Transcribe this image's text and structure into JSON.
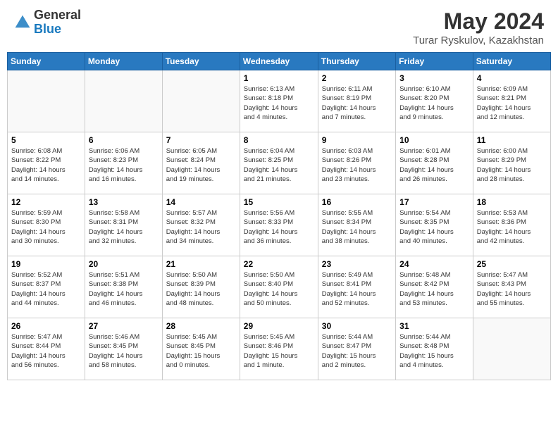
{
  "header": {
    "logo_general": "General",
    "logo_blue": "Blue",
    "title": "May 2024",
    "subtitle": "Turar Ryskulov, Kazakhstan"
  },
  "days_of_week": [
    "Sunday",
    "Monday",
    "Tuesday",
    "Wednesday",
    "Thursday",
    "Friday",
    "Saturday"
  ],
  "weeks": [
    [
      {
        "day": "",
        "info": ""
      },
      {
        "day": "",
        "info": ""
      },
      {
        "day": "",
        "info": ""
      },
      {
        "day": "1",
        "info": "Sunrise: 6:13 AM\nSunset: 8:18 PM\nDaylight: 14 hours\nand 4 minutes."
      },
      {
        "day": "2",
        "info": "Sunrise: 6:11 AM\nSunset: 8:19 PM\nDaylight: 14 hours\nand 7 minutes."
      },
      {
        "day": "3",
        "info": "Sunrise: 6:10 AM\nSunset: 8:20 PM\nDaylight: 14 hours\nand 9 minutes."
      },
      {
        "day": "4",
        "info": "Sunrise: 6:09 AM\nSunset: 8:21 PM\nDaylight: 14 hours\nand 12 minutes."
      }
    ],
    [
      {
        "day": "5",
        "info": "Sunrise: 6:08 AM\nSunset: 8:22 PM\nDaylight: 14 hours\nand 14 minutes."
      },
      {
        "day": "6",
        "info": "Sunrise: 6:06 AM\nSunset: 8:23 PM\nDaylight: 14 hours\nand 16 minutes."
      },
      {
        "day": "7",
        "info": "Sunrise: 6:05 AM\nSunset: 8:24 PM\nDaylight: 14 hours\nand 19 minutes."
      },
      {
        "day": "8",
        "info": "Sunrise: 6:04 AM\nSunset: 8:25 PM\nDaylight: 14 hours\nand 21 minutes."
      },
      {
        "day": "9",
        "info": "Sunrise: 6:03 AM\nSunset: 8:26 PM\nDaylight: 14 hours\nand 23 minutes."
      },
      {
        "day": "10",
        "info": "Sunrise: 6:01 AM\nSunset: 8:28 PM\nDaylight: 14 hours\nand 26 minutes."
      },
      {
        "day": "11",
        "info": "Sunrise: 6:00 AM\nSunset: 8:29 PM\nDaylight: 14 hours\nand 28 minutes."
      }
    ],
    [
      {
        "day": "12",
        "info": "Sunrise: 5:59 AM\nSunset: 8:30 PM\nDaylight: 14 hours\nand 30 minutes."
      },
      {
        "day": "13",
        "info": "Sunrise: 5:58 AM\nSunset: 8:31 PM\nDaylight: 14 hours\nand 32 minutes."
      },
      {
        "day": "14",
        "info": "Sunrise: 5:57 AM\nSunset: 8:32 PM\nDaylight: 14 hours\nand 34 minutes."
      },
      {
        "day": "15",
        "info": "Sunrise: 5:56 AM\nSunset: 8:33 PM\nDaylight: 14 hours\nand 36 minutes."
      },
      {
        "day": "16",
        "info": "Sunrise: 5:55 AM\nSunset: 8:34 PM\nDaylight: 14 hours\nand 38 minutes."
      },
      {
        "day": "17",
        "info": "Sunrise: 5:54 AM\nSunset: 8:35 PM\nDaylight: 14 hours\nand 40 minutes."
      },
      {
        "day": "18",
        "info": "Sunrise: 5:53 AM\nSunset: 8:36 PM\nDaylight: 14 hours\nand 42 minutes."
      }
    ],
    [
      {
        "day": "19",
        "info": "Sunrise: 5:52 AM\nSunset: 8:37 PM\nDaylight: 14 hours\nand 44 minutes."
      },
      {
        "day": "20",
        "info": "Sunrise: 5:51 AM\nSunset: 8:38 PM\nDaylight: 14 hours\nand 46 minutes."
      },
      {
        "day": "21",
        "info": "Sunrise: 5:50 AM\nSunset: 8:39 PM\nDaylight: 14 hours\nand 48 minutes."
      },
      {
        "day": "22",
        "info": "Sunrise: 5:50 AM\nSunset: 8:40 PM\nDaylight: 14 hours\nand 50 minutes."
      },
      {
        "day": "23",
        "info": "Sunrise: 5:49 AM\nSunset: 8:41 PM\nDaylight: 14 hours\nand 52 minutes."
      },
      {
        "day": "24",
        "info": "Sunrise: 5:48 AM\nSunset: 8:42 PM\nDaylight: 14 hours\nand 53 minutes."
      },
      {
        "day": "25",
        "info": "Sunrise: 5:47 AM\nSunset: 8:43 PM\nDaylight: 14 hours\nand 55 minutes."
      }
    ],
    [
      {
        "day": "26",
        "info": "Sunrise: 5:47 AM\nSunset: 8:44 PM\nDaylight: 14 hours\nand 56 minutes."
      },
      {
        "day": "27",
        "info": "Sunrise: 5:46 AM\nSunset: 8:45 PM\nDaylight: 14 hours\nand 58 minutes."
      },
      {
        "day": "28",
        "info": "Sunrise: 5:45 AM\nSunset: 8:45 PM\nDaylight: 15 hours\nand 0 minutes."
      },
      {
        "day": "29",
        "info": "Sunrise: 5:45 AM\nSunset: 8:46 PM\nDaylight: 15 hours\nand 1 minute."
      },
      {
        "day": "30",
        "info": "Sunrise: 5:44 AM\nSunset: 8:47 PM\nDaylight: 15 hours\nand 2 minutes."
      },
      {
        "day": "31",
        "info": "Sunrise: 5:44 AM\nSunset: 8:48 PM\nDaylight: 15 hours\nand 4 minutes."
      },
      {
        "day": "",
        "info": ""
      }
    ]
  ]
}
